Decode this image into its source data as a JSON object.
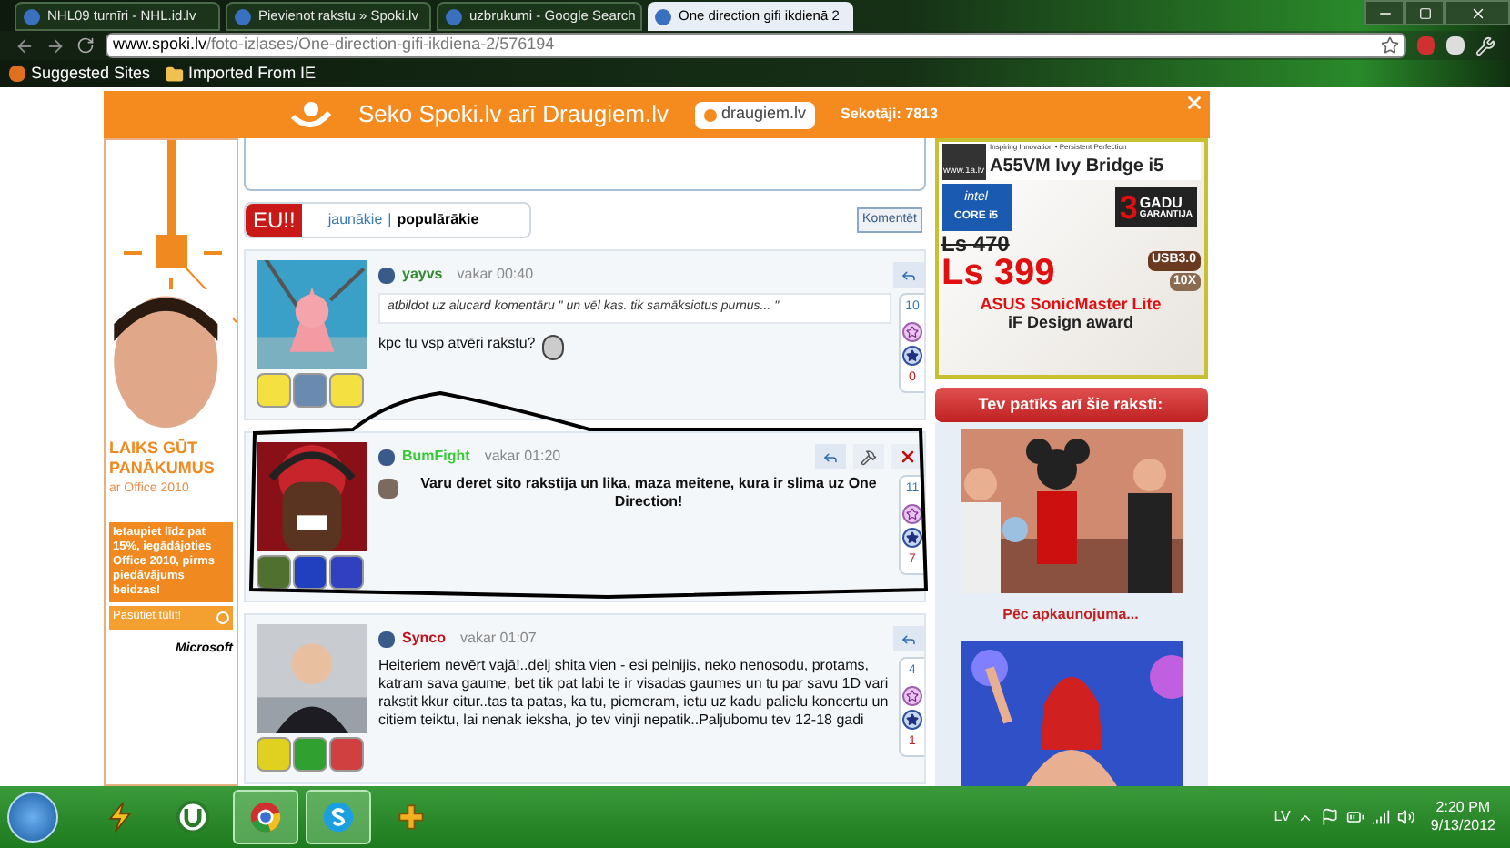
{
  "browser": {
    "tabs": [
      {
        "title": "NHL09 turnīri - NHL.id.lv",
        "selected": false
      },
      {
        "title": "Pievienot rakstu » Spoki.lv",
        "selected": false
      },
      {
        "title": "uzbrukumi - Google Search",
        "selected": false
      },
      {
        "title": "One direction gifi ikdienā 2",
        "selected": true
      }
    ],
    "address": {
      "host": "www.spoki.lv",
      "path": "/foto-izlases/One-direction-gifi-ikdiena-2/576194"
    },
    "bookmarks": [
      "Suggested Sites",
      "Imported From IE"
    ]
  },
  "follow_bar": {
    "text": "Seko Spoki.lv arī Draugiem.lv",
    "button": "draugiem.lv",
    "followers": "Sekotāji: 7813"
  },
  "left_ad": {
    "headline": "LAIKS GŪT PANĀKUMUS",
    "subline": "ar Office 2010",
    "offer": "Ietaupiet līdz pat 15%, iegādājoties Office 2010, pirms piedāvājums beidzas!",
    "button": "Pasūtiet tūlīt!",
    "brand": "Microsoft"
  },
  "comments_toolbar": {
    "logo": "EU!!",
    "separator": "|",
    "button": "Komentēt",
    "sort": [
      {
        "label": "jaunākie",
        "selected": false
      },
      {
        "label": "populārākie",
        "selected": true
      }
    ]
  },
  "comments": [
    {
      "user": "yayvs",
      "color": "#2e8b2e",
      "time": "vakar 00:40",
      "quote": "atbildot uz alucard komentāru \" un vēl kas. tik samāksiotus purnus... \"",
      "text": "kpc tu vsp atvēri rakstu?",
      "bold": false,
      "moderation": false,
      "plus": "10",
      "minus": "0"
    },
    {
      "user": "BumFight",
      "color": "#33cc33",
      "time": "vakar 01:20",
      "text": "Varu deret sito rakstija un lika, maza meitene, kura ir slima uz One Direction!",
      "bold": true,
      "moderation": true,
      "plus": "11",
      "minus": "7"
    },
    {
      "user": "Synco",
      "color": "#c0101a",
      "time": "vakar 01:07",
      "text": "Heiteriem nevērt vajā!..delj shita vien - esi pelnijis, neko nenosodu, protams, katram sava gaume, bet tik pat labi te ir visadas gaumes un tu par savu 1D vari rakstit kkur citur..tas ta patas, ka tu, piemeram, ietu uz kadu palielu koncertu un citiem teiktu, lai nenak ieksha, jo tev vinji nepatik..Paljubomu tev 12-18 gadi",
      "bold": false,
      "moderation": false,
      "plus": "4",
      "minus": "1"
    }
  ],
  "right_ad": {
    "site": "www.1a.lv",
    "tagline": "Inspiring Innovation • Persistent Perfection",
    "model": "A55VM Ivy Bridge i5",
    "chip": "intel",
    "chip_line": "CORE i5",
    "warranty_number": "3",
    "warranty_word": "GADU",
    "warranty_label": "GARANTIJA",
    "old_price": "Ls 470",
    "price": "Ls 399",
    "usb": "USB3.0",
    "zoom": "10X",
    "brand_line": "ASUS SonicMaster Lite",
    "award": "iF Design award"
  },
  "related": {
    "title": "Tev patīks arī šie raksti:",
    "captions": [
      "Pēc apkaunojuma..."
    ]
  },
  "taskbar": {
    "apps": [
      {
        "kind": "bolt",
        "selected": false
      },
      {
        "kind": "torrent",
        "selected": false
      },
      {
        "kind": "chrome",
        "selected": true
      },
      {
        "kind": "skype",
        "selected": true
      },
      {
        "kind": "game",
        "selected": false
      }
    ],
    "language": "LV",
    "time": "2:20 PM",
    "date": "9/13/2012"
  }
}
